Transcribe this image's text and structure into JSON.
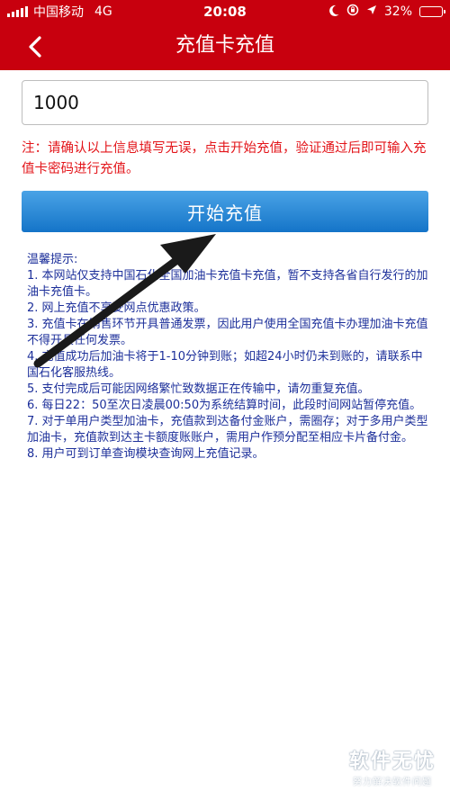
{
  "status_bar": {
    "carrier": "中国移动",
    "network": "4G",
    "time": "20:08",
    "battery": "32%",
    "battery_level": 0.32
  },
  "header": {
    "title": "充值卡充值",
    "back_icon": "chevron-left-icon"
  },
  "form": {
    "amount_value": "1000",
    "notice": "注：请确认以上信息填写无误，点击开始充值，验证通过后即可输入充值卡密码进行充值。",
    "start_button_label": "开始充值"
  },
  "tips": {
    "heading": "温馨提示:",
    "items": [
      "1. 本网站仅支持中国石化全国加油卡充值卡充值，暂不支持各省自行发行的加油卡充值卡。",
      "2. 网上充值不享受网点优惠政策。",
      "3. 充值卡在销售环节开具普通发票，因此用户使用全国充值卡办理加油卡充值不得开具任何发票。",
      "4. 充值成功后加油卡将于1-10分钟到账；如超24小时仍未到账的，请联系中国石化客服热线。",
      "5. 支付完成后可能因网络繁忙致数据正在传输中，请勿重复充值。",
      "6. 每日22：50至次日凌晨00:50为系统结算时间，此段时间网站暂停充值。",
      "7. 对于单用户类型加油卡，充值款到达备付金账户，需圈存；对于多用户类型加油卡，充值款到达主卡额度账账户，需用户作预分配至相应卡片备付金。",
      "8. 用户可到订单查询模块查询网上充值记录。"
    ]
  },
  "watermark": {
    "title": "软件无忧",
    "subtitle": "努力解决软件问题"
  },
  "colors": {
    "header_red": "#c8000e",
    "notice_red": "#e3151a",
    "button_blue": "#1e7fd2",
    "tips_blue": "#1c2f9a"
  }
}
